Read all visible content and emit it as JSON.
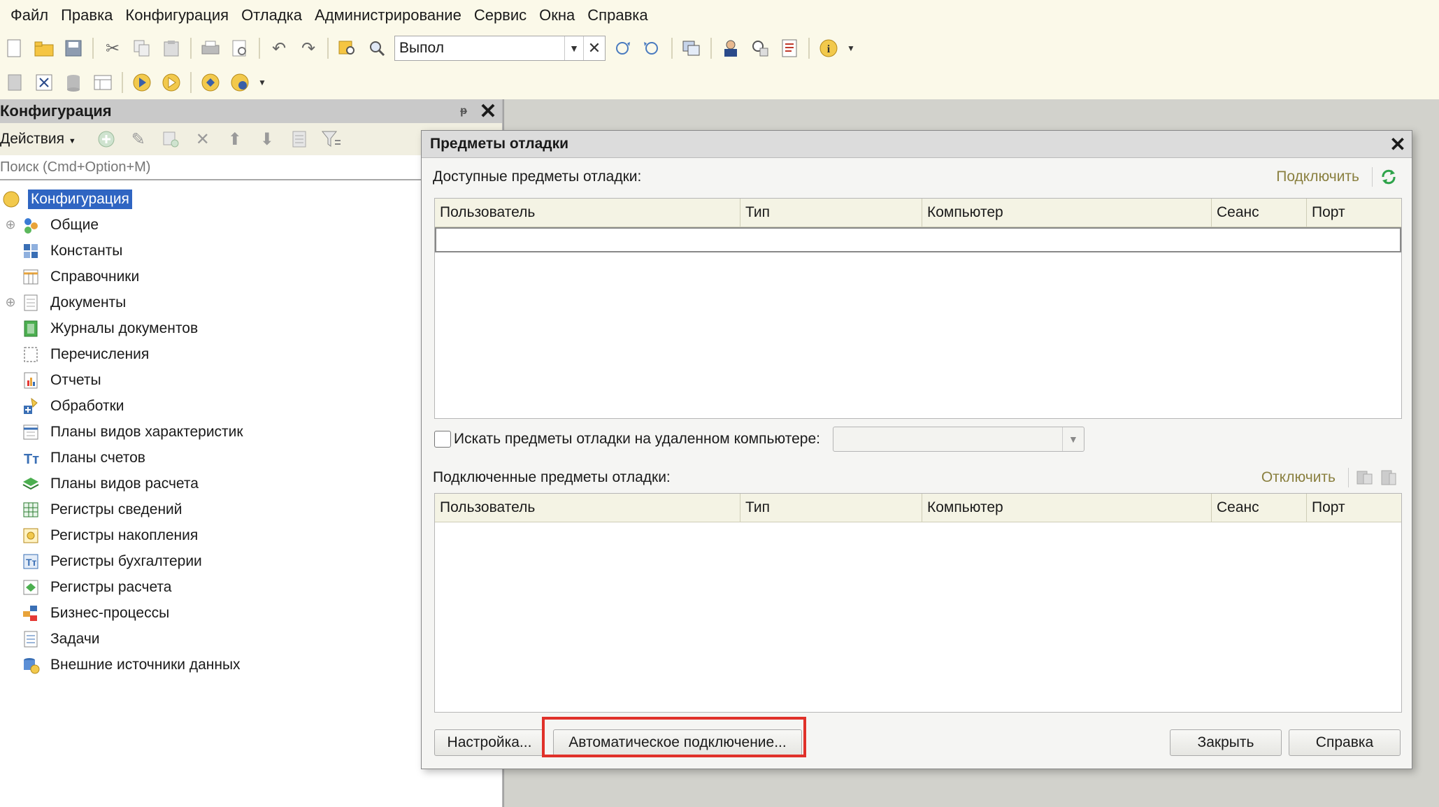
{
  "menu": [
    "Файл",
    "Правка",
    "Конфигурация",
    "Отладка",
    "Администрирование",
    "Сервис",
    "Окна",
    "Справка"
  ],
  "toolbar": {
    "search_value": "Выпол",
    "icons_row1_left": [
      "new-document-icon",
      "open-folder-icon",
      "save-icon",
      "cut-icon",
      "copy-icon",
      "paste-icon",
      "print-icon",
      "print-preview-icon",
      "undo-icon",
      "redo-icon",
      "find-in-tree-icon",
      "search-icon"
    ],
    "icons_row1_right": [
      "find-next-icon",
      "find-previous-icon",
      "windows-icon",
      "user-icon",
      "syntax-helper-icon",
      "report-icon",
      "info-icon"
    ],
    "icons_row2": [
      "config-db-icon",
      "compare-icon",
      "database-icon",
      "table-icon",
      "start-debug-icon",
      "run-icon",
      "connect-icon",
      "debug-items-icon"
    ]
  },
  "config_panel": {
    "title": "Конфигурация",
    "pin_glyph": "ᵽ",
    "actions_label": "Действия",
    "search_placeholder": "Поиск (Cmd+Option+M)",
    "tree": [
      {
        "label": "Конфигурация",
        "icon": "configuration-icon",
        "root": true
      },
      {
        "label": "Общие",
        "icon": "common-icon",
        "expandable": true
      },
      {
        "label": "Константы",
        "icon": "constants-icon"
      },
      {
        "label": "Справочники",
        "icon": "catalogs-icon"
      },
      {
        "label": "Документы",
        "icon": "documents-icon",
        "expandable": true
      },
      {
        "label": "Журналы документов",
        "icon": "document-journals-icon"
      },
      {
        "label": "Перечисления",
        "icon": "enumerations-icon"
      },
      {
        "label": "Отчеты",
        "icon": "reports-icon"
      },
      {
        "label": "Обработки",
        "icon": "data-processors-icon"
      },
      {
        "label": "Планы видов характеристик",
        "icon": "characteristic-types-icon"
      },
      {
        "label": "Планы счетов",
        "icon": "charts-of-accounts-icon"
      },
      {
        "label": "Планы видов расчета",
        "icon": "calculation-types-icon"
      },
      {
        "label": "Регистры сведений",
        "icon": "information-registers-icon"
      },
      {
        "label": "Регистры накопления",
        "icon": "accumulation-registers-icon"
      },
      {
        "label": "Регистры бухгалтерии",
        "icon": "accounting-registers-icon"
      },
      {
        "label": "Регистры расчета",
        "icon": "calculation-registers-icon"
      },
      {
        "label": "Бизнес-процессы",
        "icon": "business-processes-icon"
      },
      {
        "label": "Задачи",
        "icon": "tasks-icon"
      },
      {
        "label": "Внешние источники данных",
        "icon": "external-data-sources-icon"
      }
    ]
  },
  "dialog": {
    "title": "Предметы отладки",
    "available_label": "Доступные предметы отладки:",
    "connect_label": "Подключить",
    "columns": [
      "Пользователь",
      "Тип",
      "Компьютер",
      "Сеанс",
      "Порт"
    ],
    "remote_checkbox_label": "Искать предметы отладки на удаленном компьютере:",
    "remote_checked": false,
    "connected_label": "Подключенные предметы отладки:",
    "disconnect_label": "Отключить",
    "settings_button": "Настройка...",
    "auto_connect_button": "Автоматическое подключение...",
    "close_button": "Закрыть",
    "help_button": "Справка"
  },
  "colors": {
    "highlight": "#e0312a",
    "selection": "#2f65c2",
    "toolbar_bg": "#fbf9e9"
  }
}
